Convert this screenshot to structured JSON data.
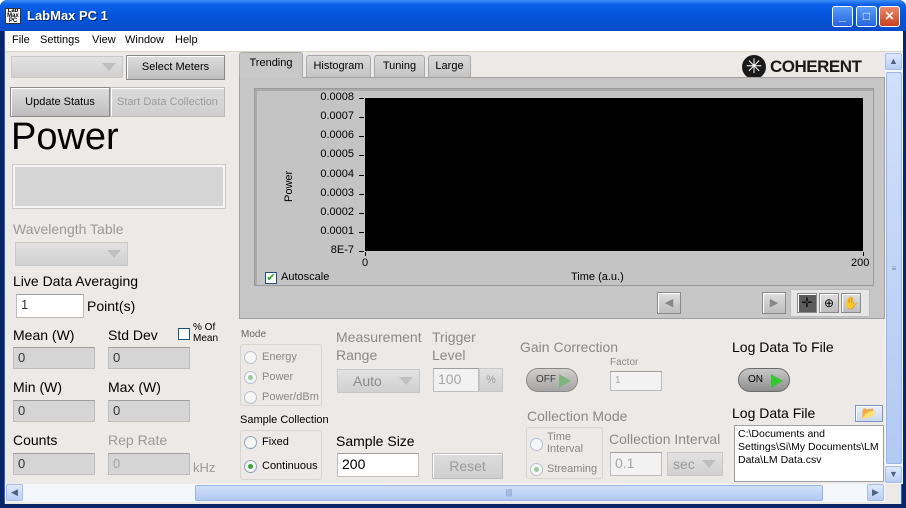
{
  "window": {
    "title": "LabMax PC 1",
    "icon_text": "Lab Max PC",
    "controls": {
      "minimize": "_",
      "maximize": "□",
      "close": "✕"
    }
  },
  "menu": [
    "File",
    "Settings",
    "View",
    "Window",
    "Help"
  ],
  "left_panel": {
    "meter_select_value": "",
    "select_meters_label": "Select Meters",
    "update_status_label": "Update Status",
    "start_collection_label": "Start Data Collection",
    "measurement_title": "Power",
    "power_readout": "",
    "wavelength_table_label": "Wavelength Table",
    "wavelength_table_value": "",
    "averaging_label": "Live Data Averaging",
    "averaging_value": "1",
    "averaging_unit": "Point(s)",
    "mean_label": "Mean (W)",
    "mean_value": "0",
    "stddev_label": "Std Dev",
    "stddev_value": "0",
    "pct_of_mean_label": "% Of Mean",
    "pct_of_mean_checked": false,
    "min_label": "Min (W)",
    "min_value": "0",
    "max_label": "Max (W)",
    "max_value": "0",
    "counts_label": "Counts",
    "counts_value": "0",
    "rep_rate_label": "Rep Rate",
    "rep_rate_value": "0",
    "rep_rate_unit": "kHz"
  },
  "brand": "COHERENT",
  "tabs": [
    {
      "label": "Trending",
      "active": true
    },
    {
      "label": "Histogram",
      "active": false
    },
    {
      "label": "Tuning",
      "active": false
    },
    {
      "label": "Large",
      "active": false
    }
  ],
  "chart_data": {
    "type": "line",
    "title": "",
    "xlabel": "Time (a.u.)",
    "ylabel": "Power",
    "xlim": [
      0,
      200
    ],
    "ylim": [
      8e-07,
      0.0008
    ],
    "x_ticks": [
      "0",
      "200"
    ],
    "y_ticks": [
      "0.0008",
      "0.0007",
      "0.0006",
      "0.0005",
      "0.0004",
      "0.0003",
      "0.0002",
      "0.0001",
      "8E-7"
    ],
    "series": [],
    "background": "#000000",
    "autoscale_label": "Autoscale",
    "autoscale_checked": true
  },
  "settings": {
    "mode_label": "Mode",
    "modes": [
      {
        "label": "Energy",
        "selected": false
      },
      {
        "label": "Power",
        "selected": true
      },
      {
        "label": "Power/dBm",
        "selected": false
      }
    ],
    "sample_collection_label": "Sample Collection",
    "sample_collection": [
      {
        "label": "Fixed",
        "selected": false
      },
      {
        "label": "Continuous",
        "selected": true
      }
    ],
    "measurement_range_label": "Measurement Range",
    "measurement_range_value": "Auto",
    "trigger_level_label": "Trigger Level",
    "trigger_level_value": "100",
    "trigger_level_unit": "%",
    "sample_size_label": "Sample Size",
    "sample_size_value": "200",
    "reset_label": "Reset",
    "gain_correction_label": "Gain Correction",
    "gain_correction_state": "OFF",
    "factor_label": "Factor",
    "factor_value": "1",
    "collection_mode_label": "Collection Mode",
    "collection_modes": [
      {
        "label": "Time Interval",
        "selected": false
      },
      {
        "label": "Streaming",
        "selected": true
      }
    ],
    "collection_interval_label": "Collection Interval",
    "collection_interval_value": "0.1",
    "collection_interval_unit": "sec",
    "log_to_file_label": "Log Data To File",
    "log_to_file_state": "ON",
    "log_file_label": "Log Data File",
    "log_file_path": "C:\\Documents and Settings\\Si\\My Documents\\LM Data\\LM Data.csv"
  }
}
